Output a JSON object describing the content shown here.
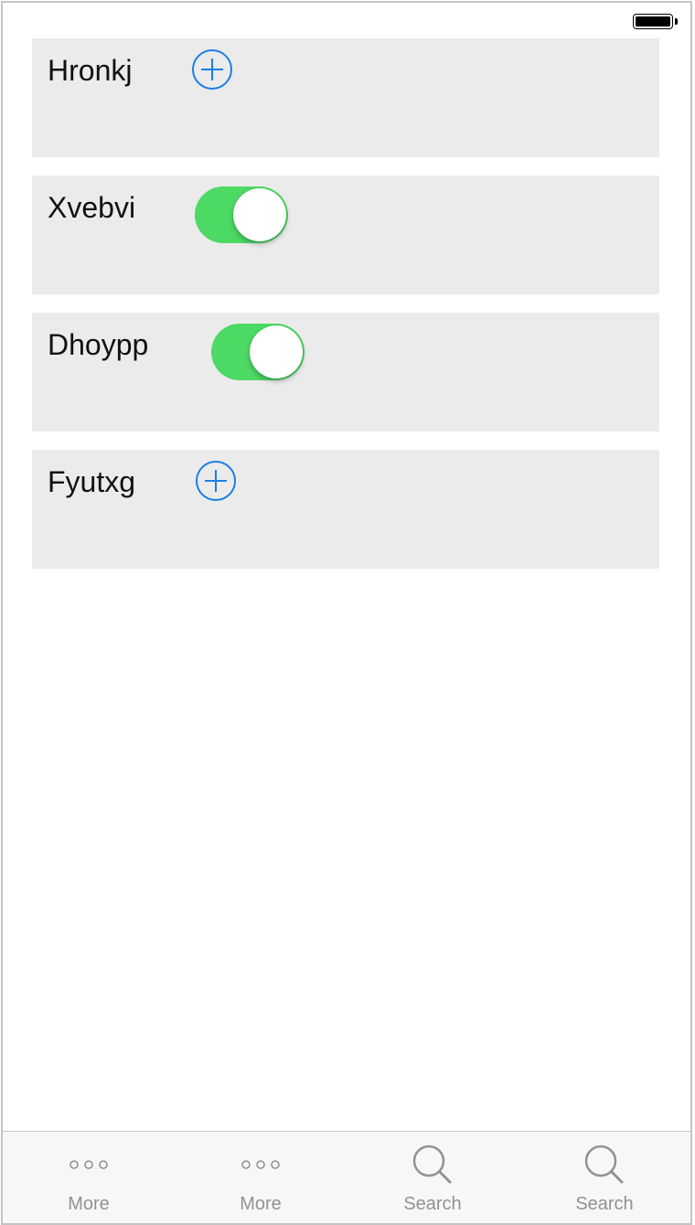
{
  "status_bar": {
    "battery_icon": "battery-full-icon"
  },
  "rows": [
    {
      "label": "Hronkj",
      "control": "add-button",
      "icon": "plus-circle-icon"
    },
    {
      "label": "Xvebvi",
      "control": "toggle",
      "checked": true
    },
    {
      "label": "Dhoypp",
      "control": "toggle",
      "checked": true
    },
    {
      "label": "Fyutxg",
      "control": "add-button",
      "icon": "plus-circle-icon"
    }
  ],
  "tab_bar": {
    "items": [
      {
        "label": "More",
        "icon": "more-icon"
      },
      {
        "label": "More",
        "icon": "more-icon"
      },
      {
        "label": "Search",
        "icon": "search-icon"
      },
      {
        "label": "Search",
        "icon": "search-icon"
      }
    ]
  },
  "colors": {
    "card_background": "#ebebeb",
    "toggle_on": "#4cd964",
    "accent_blue": "#1a7fe6",
    "tab_inactive": "#929292"
  }
}
